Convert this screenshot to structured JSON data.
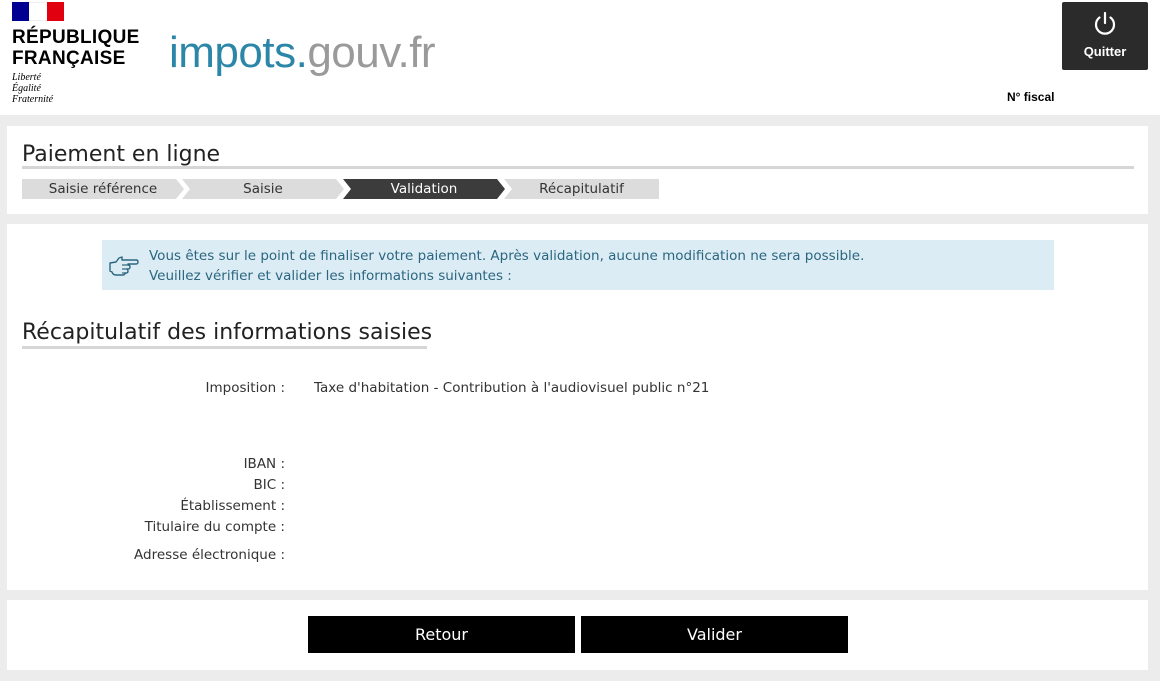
{
  "header": {
    "republique_line1": "RÉPUBLIQUE",
    "republique_line2": "FRANÇAISE",
    "devise": [
      "Liberté",
      "Égalité",
      "Fraternité"
    ],
    "logo_part1": "impots.",
    "logo_part2": "gouv.fr",
    "quit_label": "Quitter",
    "fiscal_label": "N° fiscal",
    "flag_colors": [
      "#000091",
      "#ffffff",
      "#e1000f"
    ]
  },
  "page": {
    "title": "Paiement en ligne",
    "steps": [
      {
        "label": "Saisie référence",
        "state": "done"
      },
      {
        "label": "Saisie",
        "state": "done"
      },
      {
        "label": "Validation",
        "state": "active"
      },
      {
        "label": "Récapitulatif",
        "state": "todo"
      }
    ]
  },
  "info": {
    "icon": "pointing-hand-icon",
    "line1": "Vous êtes sur le point de finaliser votre paiement. Après validation, aucune modification ne sera possible.",
    "line2": "Veuillez vérifier et valider les informations suivantes :"
  },
  "summary": {
    "title": "Récapitulatif des informations saisies",
    "fields": [
      {
        "label": "Imposition :",
        "value": "Taxe d'habitation - Contribution à l'audiovisuel public n°21"
      },
      {
        "label": "IBAN :",
        "value": ""
      },
      {
        "label": "BIC :",
        "value": ""
      },
      {
        "label": "Établissement :",
        "value": ""
      },
      {
        "label": "Titulaire du compte :",
        "value": ""
      },
      {
        "label": "Adresse électronique :",
        "value": ""
      }
    ]
  },
  "actions": {
    "back_label": "Retour",
    "validate_label": "Valider"
  },
  "colors": {
    "accent_blue": "#2b86a8",
    "info_bg": "#dcecf4",
    "info_text": "#2b6680",
    "active_step": "#3c3c3c"
  }
}
